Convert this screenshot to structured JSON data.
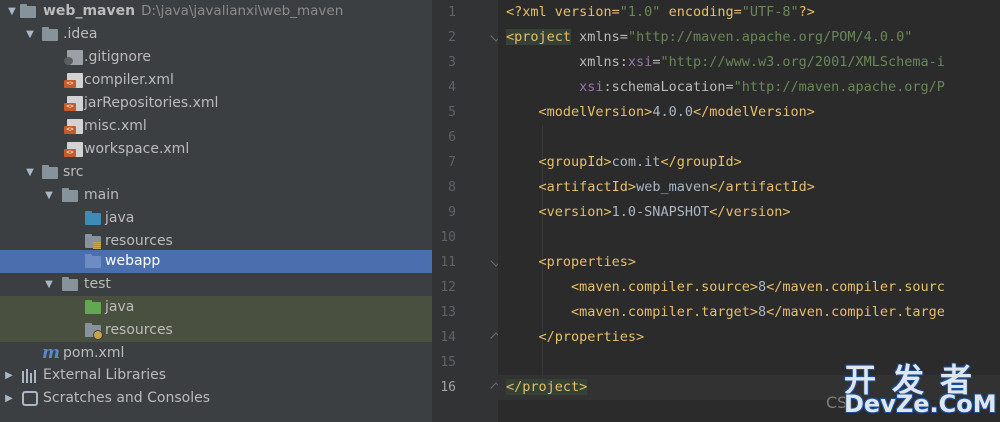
{
  "project_tree": {
    "root": {
      "name": "web_maven",
      "path": "D:\\java\\javalianxi\\web_maven"
    },
    "idea_folder": ".idea",
    "idea_files": [
      ".gitignore",
      "compiler.xml",
      "jarRepositories.xml",
      "misc.xml",
      "workspace.xml"
    ],
    "src": "src",
    "main": "main",
    "main_children": [
      "java",
      "resources",
      "webapp"
    ],
    "test": "test",
    "test_children": [
      "java",
      "resources"
    ],
    "pom": "pom.xml",
    "external_libraries": "External Libraries",
    "scratches": "Scratches and Consoles",
    "selected_item": "webapp"
  },
  "editor": {
    "line_numbers": [
      "1",
      "2",
      "3",
      "4",
      "5",
      "6",
      "7",
      "8",
      "9",
      "10",
      "11",
      "12",
      "13",
      "14",
      "15",
      "16"
    ],
    "current_line": "16",
    "lines": [
      [
        {
          "t": "<?xml version=",
          "c": "tag"
        },
        {
          "t": "\"1.0\"",
          "c": "val"
        },
        {
          "t": " encoding=",
          "c": "tag"
        },
        {
          "t": "\"UTF-8\"",
          "c": "val"
        },
        {
          "t": "?>",
          "c": "tag"
        }
      ],
      [
        {
          "t": "<project",
          "c": "tag",
          "hl": true
        },
        {
          "t": " xmlns=",
          "c": "attr"
        },
        {
          "t": "\"http://maven.apache.org/POM/4.0.0\"",
          "c": "val"
        }
      ],
      [
        {
          "t": "         xmlns:",
          "c": "attr"
        },
        {
          "t": "xsi",
          "c": "ns"
        },
        {
          "t": "=",
          "c": "attr"
        },
        {
          "t": "\"http://www.w3.org/2001/XMLSchema-i",
          "c": "val"
        }
      ],
      [
        {
          "t": "         ",
          "c": "attr"
        },
        {
          "t": "xsi",
          "c": "ns"
        },
        {
          "t": ":schemaLocation=",
          "c": "attr"
        },
        {
          "t": "\"http://maven.apache.org/P",
          "c": "val"
        }
      ],
      [
        {
          "t": "    ",
          "c": "txt"
        },
        {
          "t": "<modelVersion>",
          "c": "tag"
        },
        {
          "t": "4.0.0",
          "c": "txt"
        },
        {
          "t": "</modelVersion>",
          "c": "tag"
        }
      ],
      [],
      [
        {
          "t": "    ",
          "c": "txt"
        },
        {
          "t": "<groupId>",
          "c": "tag"
        },
        {
          "t": "com.it",
          "c": "txt"
        },
        {
          "t": "</groupId>",
          "c": "tag"
        }
      ],
      [
        {
          "t": "    ",
          "c": "txt"
        },
        {
          "t": "<artifactId>",
          "c": "tag"
        },
        {
          "t": "web_maven",
          "c": "txt"
        },
        {
          "t": "</artifactId>",
          "c": "tag"
        }
      ],
      [
        {
          "t": "    ",
          "c": "txt"
        },
        {
          "t": "<version>",
          "c": "tag"
        },
        {
          "t": "1.0-SNAPSHOT",
          "c": "txt"
        },
        {
          "t": "</version>",
          "c": "tag"
        }
      ],
      [],
      [
        {
          "t": "    ",
          "c": "txt"
        },
        {
          "t": "<properties>",
          "c": "tag"
        }
      ],
      [
        {
          "t": "        ",
          "c": "txt"
        },
        {
          "t": "<maven.compiler.source>",
          "c": "tag"
        },
        {
          "t": "8",
          "c": "txt"
        },
        {
          "t": "</maven.compiler.sourc",
          "c": "tag"
        }
      ],
      [
        {
          "t": "        ",
          "c": "txt"
        },
        {
          "t": "<maven.compiler.target>",
          "c": "tag"
        },
        {
          "t": "8",
          "c": "txt"
        },
        {
          "t": "</maven.compiler.targe",
          "c": "tag"
        }
      ],
      [
        {
          "t": "    ",
          "c": "txt"
        },
        {
          "t": "</properties>",
          "c": "tag"
        }
      ],
      [],
      [
        {
          "t": "</project>",
          "c": "tag",
          "hl": true
        }
      ]
    ]
  },
  "watermark": {
    "site": "CS",
    "cn": "开发者",
    "en": "DevZe.CoM"
  },
  "colors": {
    "selection": "#4b6eaf",
    "test_bg": "#49503f",
    "tag": "#e8bf6a",
    "string": "#6a8759",
    "namespace": "#9876aa"
  }
}
